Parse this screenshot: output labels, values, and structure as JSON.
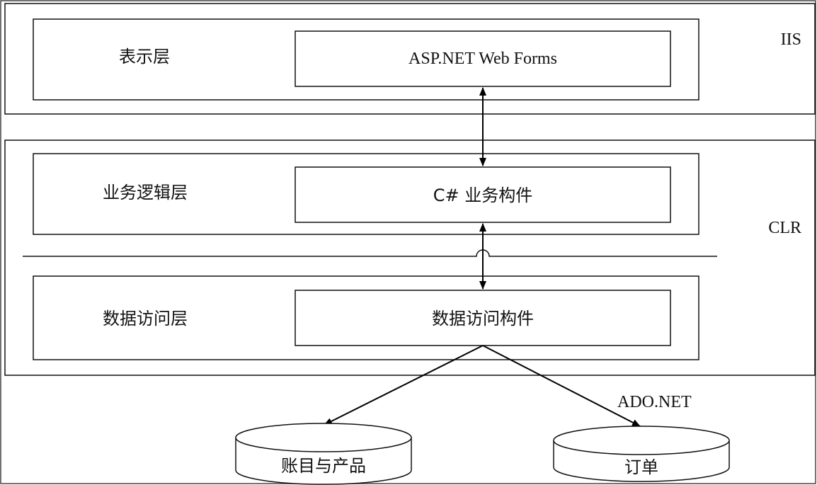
{
  "environments": {
    "iis": "IIS",
    "clr": "CLR"
  },
  "layers": {
    "presentation": {
      "label": "表示层",
      "component": "ASP.NET Web Forms"
    },
    "business": {
      "label": "业务逻辑层",
      "component": "C# 业务构件"
    },
    "data_access": {
      "label": "数据访问层",
      "component": "数据访问构件"
    }
  },
  "connector": {
    "ado": "ADO.NET"
  },
  "databases": {
    "accounts_products": "账目与产品",
    "orders": "订单"
  }
}
